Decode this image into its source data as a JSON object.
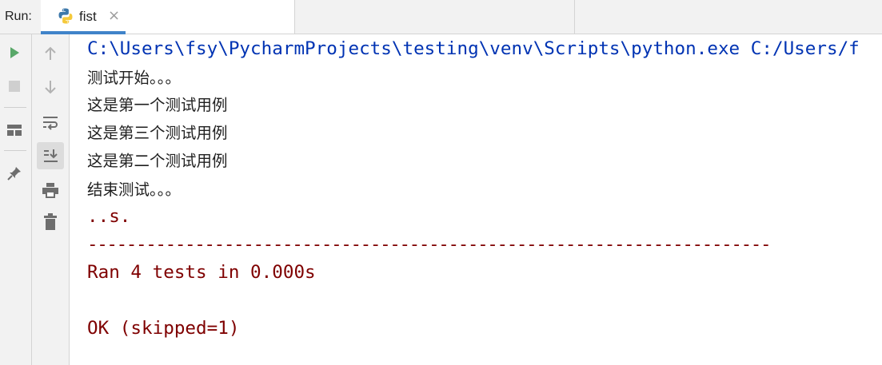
{
  "run_panel": {
    "label": "Run:",
    "tab": {
      "title": "fist",
      "close_glyph": "×",
      "icon": "python-icon"
    }
  },
  "toolbar_left": [
    {
      "name": "rerun-icon",
      "color": "#59a869"
    },
    {
      "name": "stop-icon"
    },
    {
      "name": "layout-icon"
    },
    {
      "name": "pin-icon"
    }
  ],
  "toolbar_right": [
    {
      "name": "up-arrow-icon"
    },
    {
      "name": "down-arrow-icon"
    },
    {
      "name": "soft-wrap-icon"
    },
    {
      "name": "scroll-to-end-icon",
      "active": true
    },
    {
      "name": "print-icon"
    },
    {
      "name": "trash-icon"
    }
  ],
  "console": {
    "command": "C:\\Users\\fsy\\PycharmProjects\\testing\\venv\\Scripts\\python.exe C:/Users/f",
    "lines": [
      "测试开始。。。",
      "这是第一个测试用例",
      "这是第三个测试用例",
      "这是第二个测试用例",
      "结束测试。。。"
    ],
    "result_dots": "..s.",
    "separator": "----------------------------------------------------------------------",
    "ran": "Ran 4 tests in 0.000s",
    "status": "OK (skipped=1)"
  },
  "colors": {
    "command": "#0033b3",
    "stdout": "#1f1f1f",
    "stderr": "#7f0000",
    "tab_underline": "#4083c9"
  }
}
